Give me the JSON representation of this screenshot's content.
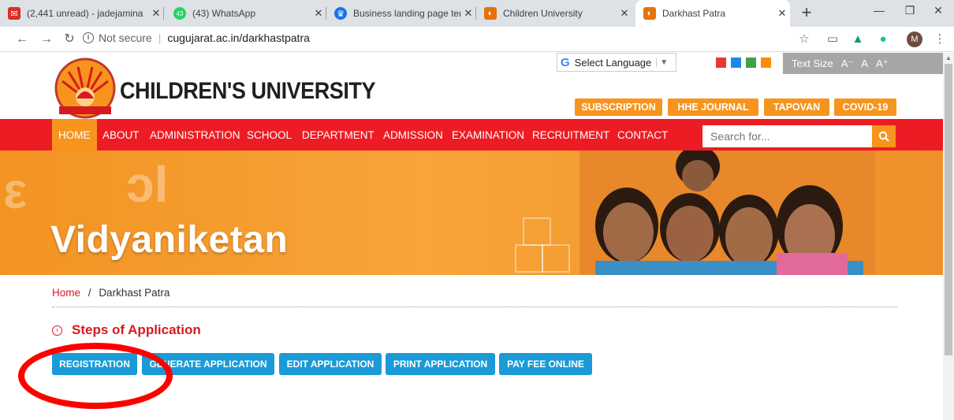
{
  "browser": {
    "tabs": [
      {
        "label": "(2,441 unread) - jadejamina",
        "icon": "gmail-icon",
        "color": "#d93025"
      },
      {
        "label": "(43) WhatsApp",
        "icon": "whatsapp-icon",
        "color": "#25d366",
        "badge": "43"
      },
      {
        "label": "Business landing page temp",
        "icon": "crown-icon",
        "color": "#1a73e8"
      },
      {
        "label": "Children University",
        "icon": "site-icon",
        "color": "#e8710a"
      },
      {
        "label": "Darkhast Patra",
        "icon": "site-icon",
        "color": "#e8710a"
      }
    ],
    "close_glyph": "✕",
    "newtab_glyph": "+",
    "address": {
      "security": "Not secure",
      "url": "cugujarat.ac.in/darkhastpatra"
    },
    "profile_initial": "M"
  },
  "site": {
    "brand": "CHILDREN'S UNIVERSITY",
    "translate_label": "Select Language",
    "text_size": {
      "label": "Text Size",
      "small": "A⁻",
      "normal": "A",
      "large": "A⁺"
    },
    "theme_colors": [
      "#e53935",
      "#1e88e5",
      "#43a047",
      "#fb8c00"
    ],
    "top_buttons": [
      "SUBSCRIPTION",
      "HHE JOURNAL",
      "TAPOVAN",
      "COVID-19"
    ],
    "nav": [
      "HOME",
      "ABOUT",
      "ADMINISTRATION",
      "SCHOOL",
      "DEPARTMENT",
      "ADMISSION",
      "EXAMINATION",
      "RECRUITMENT",
      "CONTACT"
    ],
    "search_placeholder": "Search for...",
    "banner_title": "Vidyaniketan",
    "breadcrumb": {
      "home": "Home",
      "sep": "/",
      "current": "Darkhast Patra"
    },
    "steps_title": "Steps of Application",
    "steps": [
      "REGISTRATION",
      "GENERATE APPLICATION",
      "EDIT APPLICATION",
      "PRINT APPLICATION",
      "PAY FEE ONLINE"
    ]
  }
}
